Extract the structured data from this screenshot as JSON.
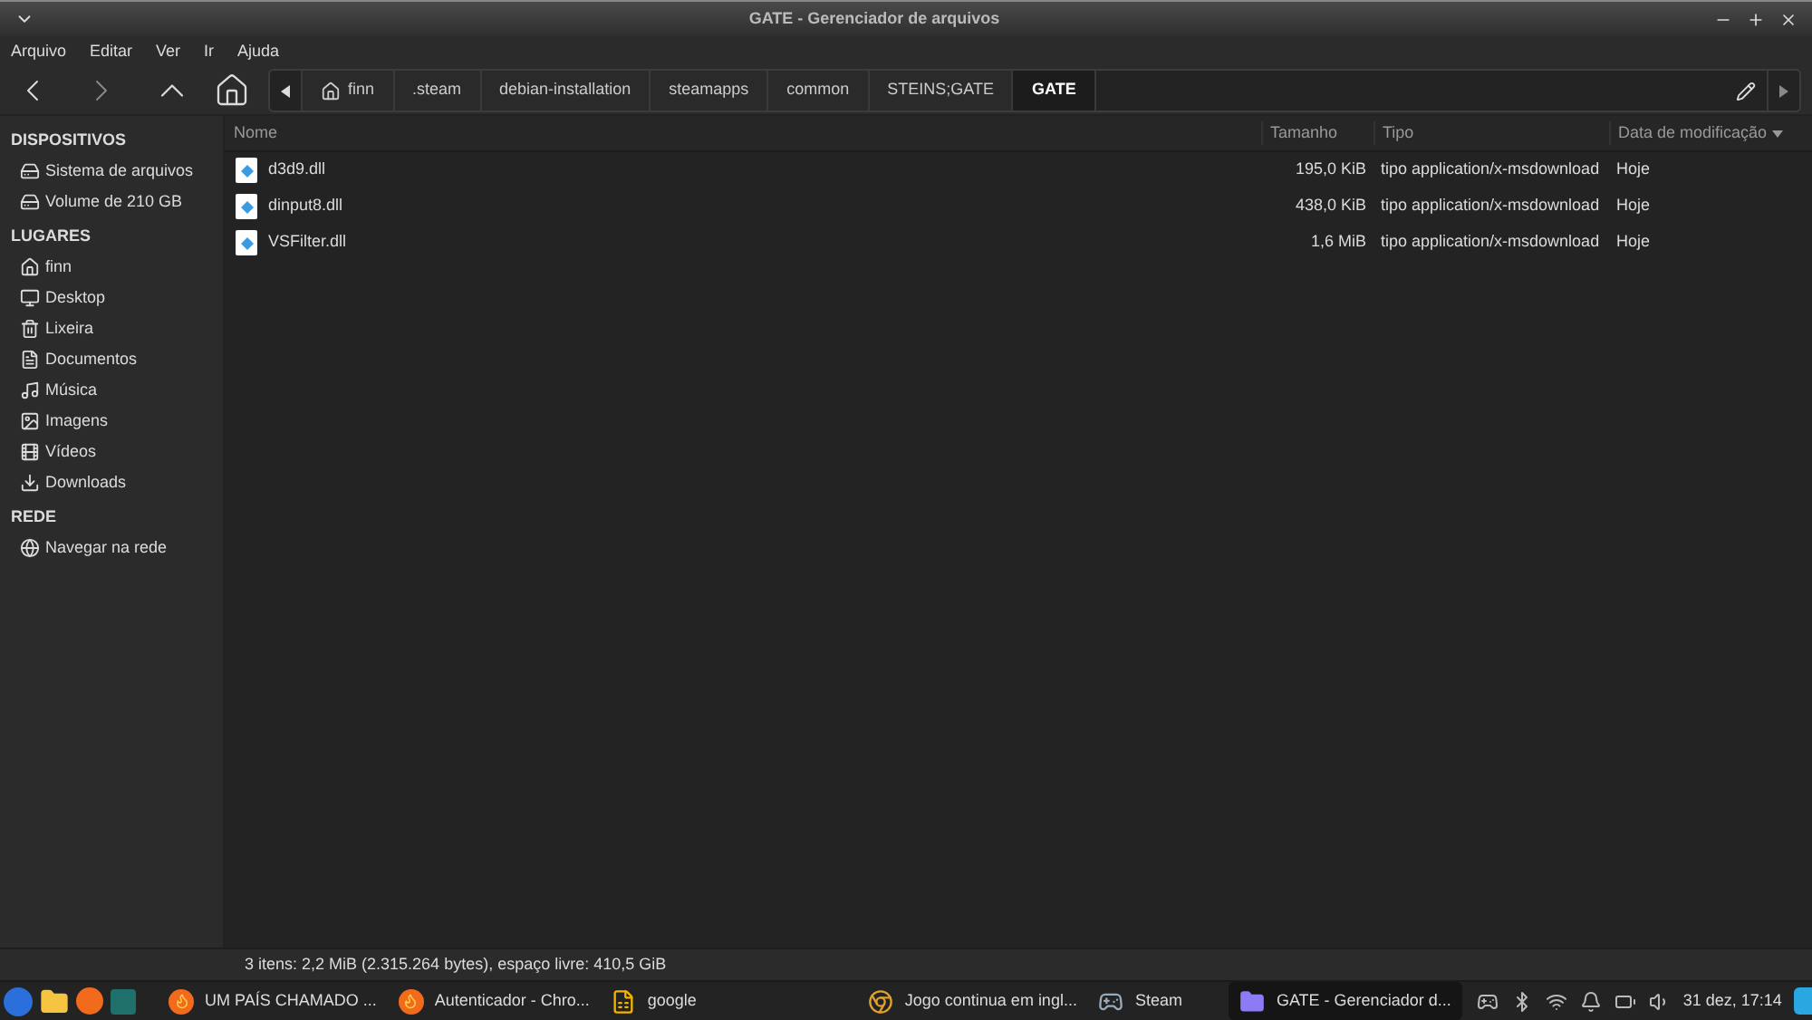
{
  "window": {
    "title": "GATE - Gerenciador de arquivos"
  },
  "menu": [
    "Arquivo",
    "Editar",
    "Ver",
    "Ir",
    "Ajuda"
  ],
  "path": [
    {
      "label": "finn",
      "kind": "home",
      "selected": false
    },
    {
      "label": ".steam",
      "kind": "folder",
      "selected": false
    },
    {
      "label": "debian-installation",
      "kind": "folder",
      "selected": false
    },
    {
      "label": "steamapps",
      "kind": "folder",
      "selected": false
    },
    {
      "label": "common",
      "kind": "folder",
      "selected": false
    },
    {
      "label": "STEINS;GATE",
      "kind": "folder",
      "selected": false
    },
    {
      "label": "GATE",
      "kind": "folder",
      "selected": true
    }
  ],
  "sidebar": [
    {
      "heading": "DISPOSITIVOS",
      "items": [
        {
          "label": "Sistema de arquivos",
          "kind": "drive"
        },
        {
          "label": "Volume de 210 GB",
          "kind": "drive"
        }
      ]
    },
    {
      "heading": "LUGARES",
      "items": [
        {
          "label": "finn",
          "kind": "home"
        },
        {
          "label": "Desktop",
          "kind": "desktop"
        },
        {
          "label": "Lixeira",
          "kind": "trash"
        },
        {
          "label": "Documentos",
          "kind": "documents"
        },
        {
          "label": "Música",
          "kind": "music"
        },
        {
          "label": "Imagens",
          "kind": "images"
        },
        {
          "label": "Vídeos",
          "kind": "videos"
        },
        {
          "label": "Downloads",
          "kind": "downloads"
        }
      ]
    },
    {
      "heading": "REDE",
      "items": [
        {
          "label": "Navegar na rede",
          "kind": "network"
        }
      ]
    }
  ],
  "table": {
    "columns": [
      "Nome",
      "Tamanho",
      "Tipo",
      "Data de modificação"
    ],
    "rows": [
      {
        "name": "d3d9.dll",
        "size": "195,0 KiB",
        "type": "tipo application/x-msdownload",
        "date": "Hoje"
      },
      {
        "name": "dinput8.dll",
        "size": "438,0 KiB",
        "type": "tipo application/x-msdownload",
        "date": "Hoje"
      },
      {
        "name": "VSFilter.dll",
        "size": "1,6 MiB",
        "type": "tipo application/x-msdownload",
        "date": "Hoje"
      }
    ]
  },
  "status_bar": "3 itens: 2,2 MiB (2.315.264 bytes), espaço livre: 410,5 GiB",
  "taskbar": {
    "tasks": [
      {
        "label": "UM PAÍS CHAMADO ...",
        "kind": "firefox",
        "selected": false
      },
      {
        "label": "Autenticador - Chro...",
        "kind": "firefox",
        "selected": false
      },
      {
        "label": "google",
        "kind": "doc",
        "selected": false
      },
      {
        "label": "Jogo continua em ingl...",
        "kind": "chrome",
        "selected": false
      },
      {
        "label": "Steam",
        "kind": "steam",
        "selected": false
      },
      {
        "label": "GATE - Gerenciador d...",
        "kind": "folder",
        "selected": true
      }
    ],
    "clock": "31 dez, 17:14"
  }
}
